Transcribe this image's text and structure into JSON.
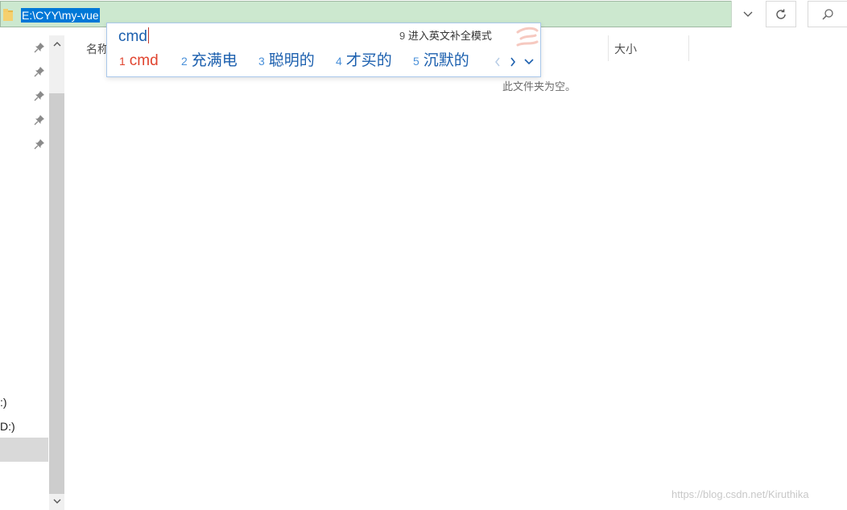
{
  "address_bar": {
    "path": "E:\\CYY\\my-vue"
  },
  "nav": {
    "drives": [
      ":)",
      "D:)"
    ]
  },
  "columns": {
    "name": "名称",
    "size": "大小"
  },
  "content": {
    "empty_message": "此文件夹为空。"
  },
  "ime": {
    "input": "cmd",
    "hint_number": "9",
    "hint_text": "进入英文补全模式",
    "candidates": [
      {
        "n": "1",
        "text": "cmd"
      },
      {
        "n": "2",
        "text": "充满电"
      },
      {
        "n": "3",
        "text": "聪明的"
      },
      {
        "n": "4",
        "text": "才买的"
      },
      {
        "n": "5",
        "text": "沉默的"
      }
    ]
  },
  "watermark": "https://blog.csdn.net/Kiruthika",
  "colors": {
    "address_bg": "#cce8cf",
    "selection": "#0078d7",
    "ime_text": "#1b5fae",
    "ime_first": "#e0442f"
  }
}
